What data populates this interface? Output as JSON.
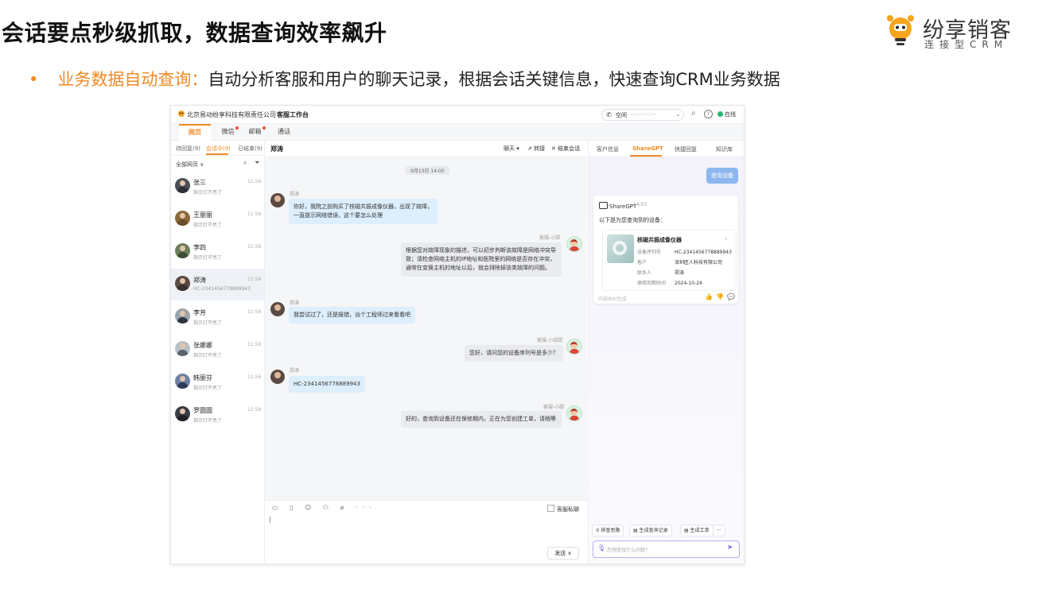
{
  "slide": {
    "title": "会话要点秒级抓取，数据查询效率飙升",
    "brand_name": "纷享销客",
    "brand_sub": "连接型CRM",
    "bullet_dot": "•",
    "bullet_key": "业务数据自动查询：",
    "bullet_text": "自动分析客服和用户的聊天记录，根据会话关键信息，快速查询CRM业务数据"
  },
  "topbar": {
    "company": "北京易动纷享科技有限责任公司",
    "workbench": "客服工作台",
    "status": "空闲",
    "phone_number": "---:--:--:---",
    "online": "在线"
  },
  "nav": {
    "tabs": [
      {
        "label": "网页",
        "active": true,
        "dot": false
      },
      {
        "label": "微信",
        "active": false,
        "dot": true
      },
      {
        "label": "邮箱",
        "active": false,
        "dot": true
      },
      {
        "label": "通话",
        "active": false,
        "dot": false
      }
    ]
  },
  "conversation_list": {
    "tabs": [
      {
        "label": "待回复(9)",
        "active": false
      },
      {
        "label": "会话中(9)",
        "active": true
      },
      {
        "label": "已结束(9)",
        "active": false
      }
    ],
    "filter_label": "全部网页 ∨",
    "contacts": [
      {
        "name": "张三",
        "time": "11:56",
        "sub": "指示灯不亮了",
        "active": false
      },
      {
        "name": "王丽丽",
        "time": "11:56",
        "sub": "指示灯不亮了",
        "active": false
      },
      {
        "name": "李四",
        "time": "11:56",
        "sub": "指示灯不亮了",
        "active": false
      },
      {
        "name": "郑涛",
        "time": "11:56",
        "sub": "HC-2341456778889943",
        "active": true
      },
      {
        "name": "李芳",
        "time": "11:56",
        "sub": "指示灯不亮了",
        "active": false
      },
      {
        "name": "张娜娜",
        "time": "11:56",
        "sub": "指示灯不亮了",
        "active": false
      },
      {
        "name": "韩丽芬",
        "time": "11:56",
        "sub": "指示灯不亮了",
        "active": false
      },
      {
        "name": "罗圆圆",
        "time": "11:56",
        "sub": "指示灯不亮了",
        "active": false
      }
    ]
  },
  "chat": {
    "title": "郑涛",
    "actions": {
      "chat": "聊天 ▾",
      "transfer": "转接",
      "end": "结束会话"
    },
    "date": "9月13日 14:00",
    "messages": [
      {
        "side": "in",
        "sender": "郑涛",
        "text": "你好，我院之前购买了核磁共振成像仪器，出现了故障，一直提示网络错误，这个要怎么处理"
      },
      {
        "side": "out",
        "sender": "客服-小甜",
        "text": "根据您对故障现象的描述，可以初步判断该故障是网络冲突导致；请检查网络主机的IP地址和医院里的网络是否存在冲突，通常在变换主机的地址以后，就会排除掉该类故障的问题。"
      },
      {
        "side": "in",
        "sender": "郑涛",
        "text": "我尝试过了，还是报错，派个工程师过来看看吧"
      },
      {
        "side": "out",
        "sender": "客服-小甜甜",
        "text": "您好，请问您的设备序列号是多少？"
      },
      {
        "side": "in",
        "sender": "郑涛",
        "text": "HC-2341456778889943"
      },
      {
        "side": "out",
        "sender": "客服-小甜",
        "text": "好的，查询到设备还在保修期内，正在为您创建工单，请稍等"
      }
    ],
    "composer": {
      "icons": "▭ ▯ ☺ ⚇ ⌀ ···",
      "private_label": "客服私聊",
      "send_label": "发送 ∨"
    }
  },
  "assistant": {
    "tabs": [
      {
        "label": "客户信息",
        "active": false
      },
      {
        "label": "ShareGPT",
        "active": true
      },
      {
        "label": "快捷回复",
        "active": false
      },
      {
        "label": "知识库",
        "active": false
      }
    ],
    "user_query": "查询设备",
    "bot_name": "ShareGPT",
    "bot_time": "14:03",
    "intro": "以下是为您查询到的设备：",
    "device": {
      "title": "核磁共振成像仪器",
      "fields": [
        {
          "key": "设备序列号",
          "value": "HC-2341456778889943"
        },
        {
          "key": "客户",
          "value": "深圳匠人科技有限公司"
        },
        {
          "key": "联系人",
          "value": "郑涛"
        },
        {
          "key": "保修到期时间",
          "value": "2024-10-24"
        }
      ]
    },
    "ai_note": "内容由AI生成",
    "quick_actions": [
      "排查思路",
      "生成查询记录",
      "生成工单",
      "···"
    ],
    "input_placeholder": "您想查找什么问题?"
  }
}
